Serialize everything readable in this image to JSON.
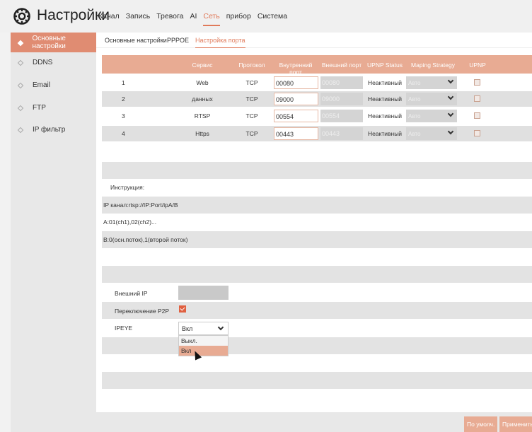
{
  "header": {
    "title": "Настройки",
    "menu": [
      "Канал",
      "Запись",
      "Тревога",
      "AI",
      "Сеть",
      "прибор",
      "Система"
    ],
    "active_menu": "Сеть"
  },
  "sidebar": {
    "items": [
      "Основные настройки",
      "DDNS",
      "Email",
      "FTP",
      "IP фильтр"
    ],
    "active": "Основные настройки"
  },
  "tabs": {
    "items": [
      "Основные настройки",
      "PPPOE",
      "Настройка порта"
    ],
    "active": "Настройка порта"
  },
  "table": {
    "headers": [
      "Сервис",
      "Протокол",
      "Внутренний порт",
      "Внешний порт",
      "UPNP Status",
      "Maping Strategy",
      "UPNP"
    ],
    "rows": [
      {
        "n": "1",
        "service": "Web",
        "protocol": "TCP",
        "internal": "00080",
        "external": "00080",
        "status": "Неактивный",
        "strategy": "Авто"
      },
      {
        "n": "2",
        "service": "данных",
        "protocol": "TCP",
        "internal": "09000",
        "external": "09000",
        "status": "Неактивный",
        "strategy": "Авто"
      },
      {
        "n": "3",
        "service": "RTSP",
        "protocol": "TCP",
        "internal": "00554",
        "external": "00554",
        "status": "Неактивный",
        "strategy": "Авто"
      },
      {
        "n": "4",
        "service": "Https",
        "protocol": "TCP",
        "internal": "00443",
        "external": "00443",
        "status": "Неактивный",
        "strategy": "Авто"
      }
    ]
  },
  "instructions": {
    "title": "Инструкция:",
    "line1": "IP канал:rtsp://IP:Port/ipA/B",
    "line2": "A:01(ch1),02(ch2)...",
    "line3": "B:0(осн.поток),1(второй поток)"
  },
  "form": {
    "external_ip_label": "Внешний IP",
    "external_ip_value": "",
    "p2p_label": "Переключение P2P",
    "p2p_checked": true,
    "ipeye_label": "IPEYE",
    "ipeye_value": "Вкл",
    "ipeye_options": [
      "Выкл.",
      "Вкл"
    ]
  },
  "footer": {
    "default_label": "По умолч.",
    "apply_label": "Применить"
  },
  "colors": {
    "accent": "#e07a5a",
    "header_row": "#e8ab93",
    "active_sidebar": "#e08c72"
  }
}
